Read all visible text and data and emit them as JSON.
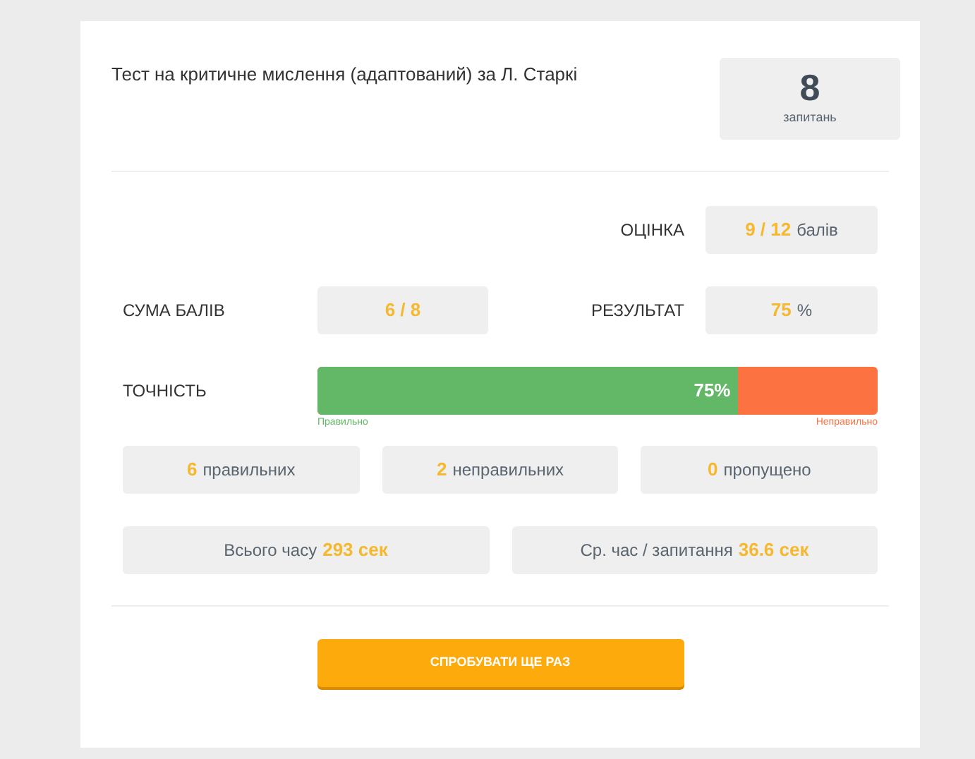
{
  "title": "Тест на критичне мислення (адаптований) за Л. Старкі",
  "question_count": {
    "value": "8",
    "label": "запитань"
  },
  "grade": {
    "label": "ОЦІНКА",
    "value": "9 / 12",
    "unit": "балів"
  },
  "score": {
    "label": "СУМА БАЛІВ",
    "value": "6 / 8"
  },
  "result": {
    "label": "РЕЗУЛЬТАТ",
    "value": "75",
    "unit": "%"
  },
  "accuracy": {
    "label": "ТОЧНІСТЬ",
    "level": 0.75,
    "reading": "75%",
    "correct_label": "Правильно",
    "wrong_label": "Неправильно"
  },
  "counts": [
    {
      "value": "6",
      "label": "правильних"
    },
    {
      "value": "2",
      "label": "неправильних"
    },
    {
      "value": "0",
      "label": "пропущено"
    }
  ],
  "times": [
    {
      "label": "Всього часу",
      "value": "293 сек"
    },
    {
      "label": "Ср. час / запитання",
      "value": "36.6 сек"
    }
  ],
  "button": "СПРОБУВАТИ ЩЕ РАЗ"
}
